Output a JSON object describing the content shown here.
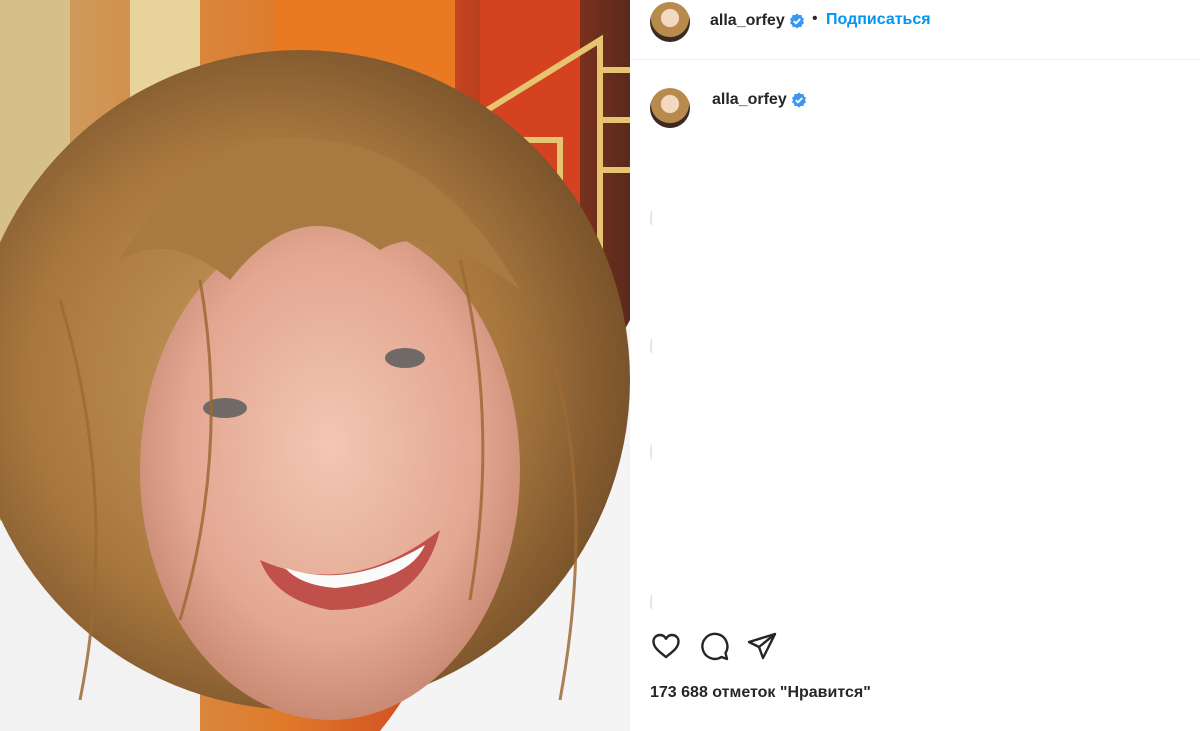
{
  "header": {
    "username": "alla_orfey",
    "separator": "•",
    "follow_label": "Подписаться"
  },
  "post": {
    "author_username": "alla_orfey",
    "likes_text": "173 688 отметок \"Нравится\""
  },
  "colors": {
    "accent": "#0095f6",
    "verified": "#3897f0",
    "text": "#262626"
  },
  "icons": {
    "like": "heart-icon",
    "comment": "comment-icon",
    "share": "share-icon",
    "verified": "verified-badge-icon"
  }
}
